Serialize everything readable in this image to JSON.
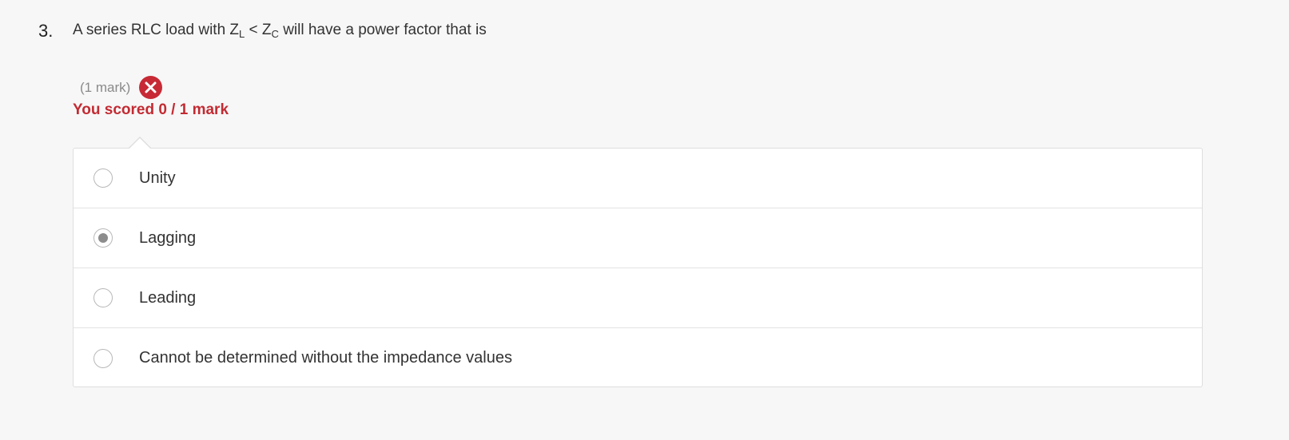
{
  "question": {
    "number": "3.",
    "text_before": "A series RLC load with Z",
    "sub_l": "L",
    "text_middle": " < Z",
    "sub_c": "C",
    "text_after": " will have a power factor that is"
  },
  "marks": {
    "label": "(1 mark)",
    "status_icon": "close-icon",
    "status_color": "#c72a35"
  },
  "score": {
    "text": "You scored 0 / 1 mark",
    "color": "#c22b33"
  },
  "options": [
    {
      "label": "Unity",
      "selected": false
    },
    {
      "label": "Lagging",
      "selected": true
    },
    {
      "label": "Leading",
      "selected": false
    },
    {
      "label": "Cannot be determined without the impedance values",
      "selected": false
    }
  ]
}
